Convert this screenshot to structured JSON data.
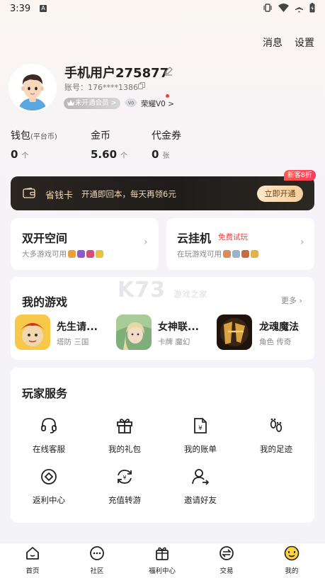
{
  "status_bar": {
    "time": "3:39",
    "a_icon": "A"
  },
  "top_actions": {
    "messages": "消息",
    "settings": "设置"
  },
  "profile": {
    "username": "手机用户275877",
    "account": "账号：176****1386",
    "vip_badge": "未开通会员 >",
    "honor_label": "荣耀V0 >"
  },
  "wallet": {
    "labels": {
      "wallet": "钱包",
      "wallet_sub": "(平台币)",
      "coins": "金币",
      "voucher": "代金券"
    },
    "values": {
      "wallet": "0",
      "coins": "5.60",
      "voucher": "0"
    },
    "units": {
      "wallet": "个",
      "coins": "个",
      "voucher": "张"
    }
  },
  "promo": {
    "tag": "新客8折",
    "title": "省钱卡",
    "subtitle": "开通即回本，每天再领6元",
    "button": "立即开通"
  },
  "feature_cards": {
    "dual": {
      "title": "双开空间",
      "subtitle": "大多游戏可用"
    },
    "cloud": {
      "title": "云挂机",
      "badge": "免费试玩",
      "subtitle": "在玩游戏可用"
    }
  },
  "watermark": {
    "main": "K73",
    "sub": "游戏之家"
  },
  "my_games": {
    "title": "我的游戏",
    "more": "更多",
    "games": [
      {
        "name": "先生请...",
        "tags": "塔防 三国",
        "icon": "game-icon-1"
      },
      {
        "name": "女神联...",
        "tags": "卡牌 魔幻",
        "icon": "game-icon-2"
      },
      {
        "name": "龙魂魔法",
        "tags": "角色 传奇",
        "icon": "game-icon-3"
      }
    ]
  },
  "services": {
    "title": "玩家服务",
    "items": [
      {
        "label": "在线客服",
        "icon": "headset-icon"
      },
      {
        "label": "我的礼包",
        "icon": "gift-icon"
      },
      {
        "label": "我的账单",
        "icon": "bill-icon"
      },
      {
        "label": "我的足迹",
        "icon": "footprint-icon"
      },
      {
        "label": "返利中心",
        "icon": "rebate-icon"
      },
      {
        "label": "充值转游",
        "icon": "recharge-transfer-icon"
      },
      {
        "label": "邀请好友",
        "icon": "invite-friend-icon"
      }
    ]
  },
  "bottom_nav": {
    "items": [
      {
        "label": "首页",
        "icon": "home-icon"
      },
      {
        "label": "社区",
        "icon": "community-icon"
      },
      {
        "label": "福利中心",
        "icon": "welfare-icon"
      },
      {
        "label": "交易",
        "icon": "trade-icon"
      },
      {
        "label": "我的",
        "icon": "mine-icon"
      }
    ]
  },
  "colors": {
    "accent_red": "#f23c3c",
    "promo_gold": "#f4d9b3",
    "promo_bg": "#221f1c"
  }
}
